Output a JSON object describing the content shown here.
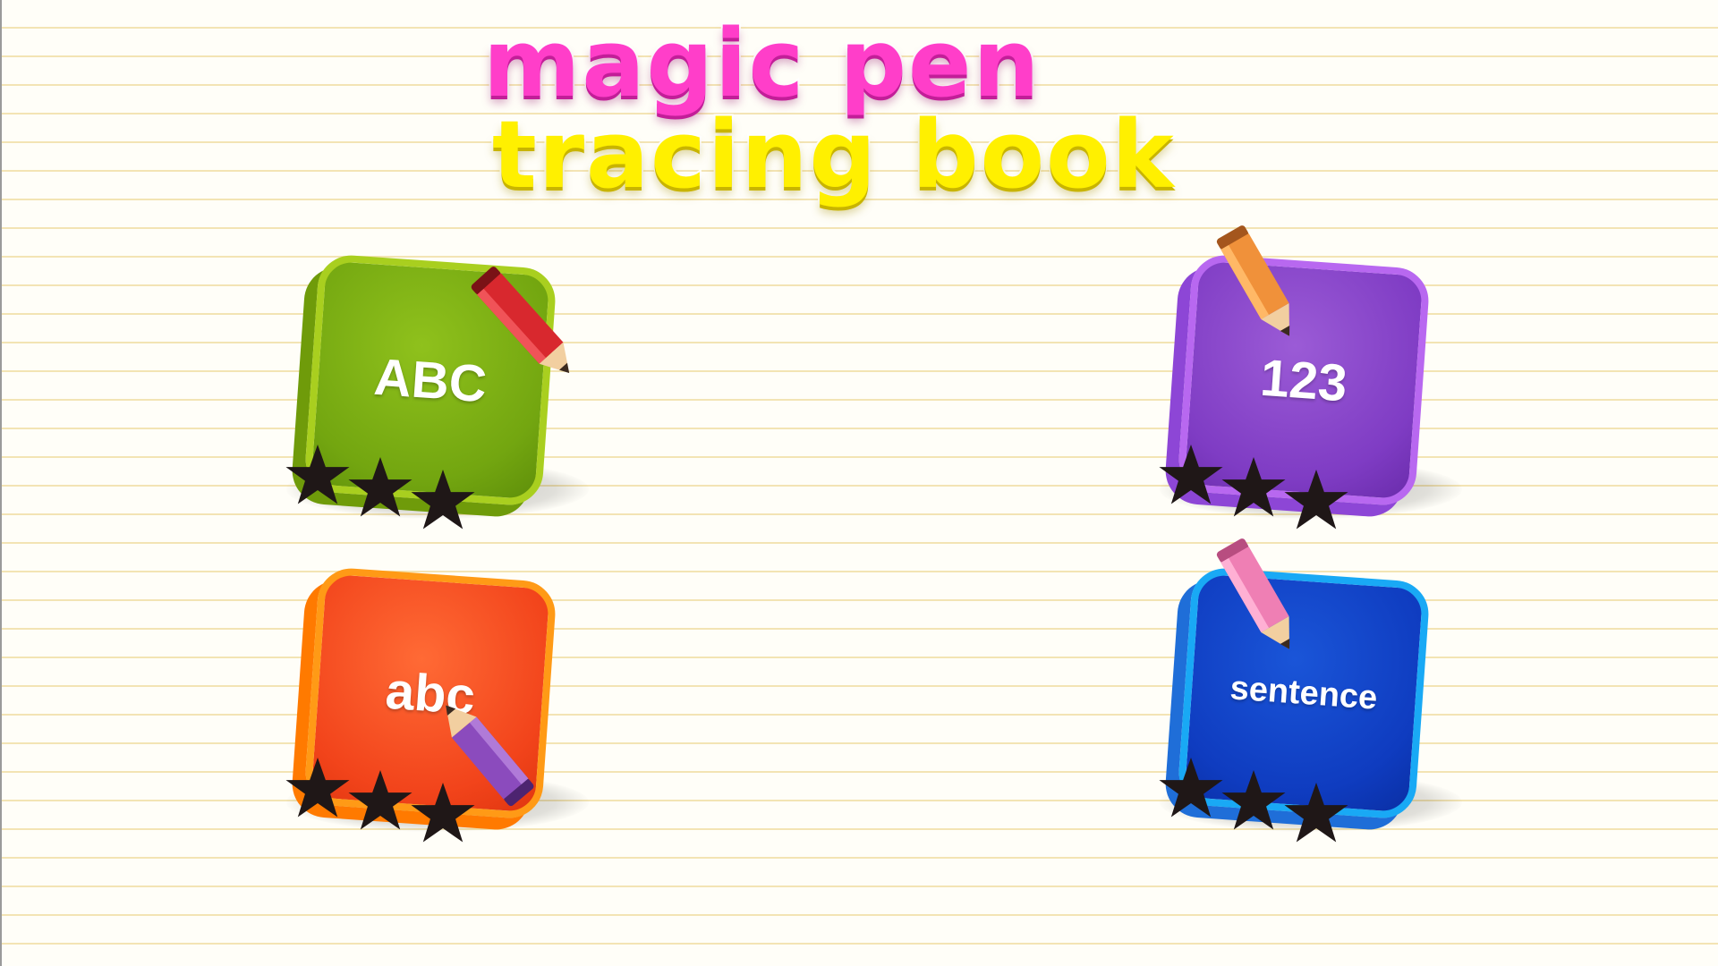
{
  "title": {
    "line1": "Magic Pen",
    "line2": "Tracing Book"
  },
  "tiles": [
    {
      "label": "ABC",
      "stars": 3,
      "pencil_color": "#d8282e"
    },
    {
      "label": "123",
      "stars": 3,
      "pencil_color": "#f0913a"
    },
    {
      "label": "abc",
      "stars": 3,
      "pencil_color": "#8b4bbd"
    },
    {
      "label": "sentence",
      "stars": 3,
      "pencil_color": "#ef7fb4"
    }
  ],
  "colors": {
    "title_line1": "#ff3ec9",
    "title_line2": "#fff000",
    "tile_abc_upper": "#7fb317",
    "tile_123": "#8a44cc",
    "tile_abc_lower": "#f2481d",
    "tile_sentence": "#1240c4",
    "star": "#1f1717"
  }
}
